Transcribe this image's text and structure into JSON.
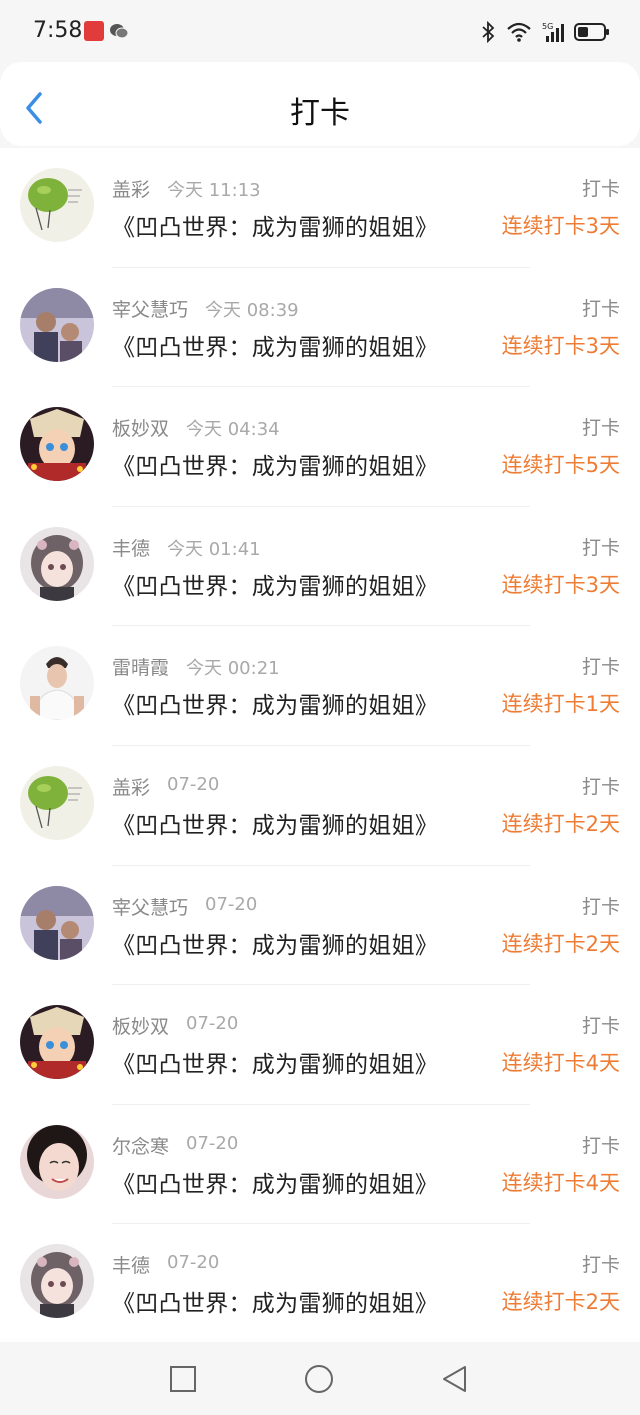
{
  "status_bar": {
    "time": "7:58",
    "network": "5G"
  },
  "header": {
    "title": "打卡"
  },
  "colors": {
    "accent": "#ef7c34",
    "back_arrow": "#3a8ee6"
  },
  "items": [
    {
      "name": "盖彩",
      "time": "今天 11:13",
      "book": "《凹凸世界：成为雷狮的姐姐》",
      "kind": "打卡",
      "streak": "连续打卡3天",
      "avatar": "lime-photo"
    },
    {
      "name": "宰父慧巧",
      "time": "今天 08:39",
      "book": "《凹凸世界：成为雷狮的姐姐》",
      "kind": "打卡",
      "streak": "连续打卡3天",
      "avatar": "group-photo"
    },
    {
      "name": "板妙双",
      "time": "今天 04:34",
      "book": "《凹凸世界：成为雷狮的姐姐》",
      "kind": "打卡",
      "streak": "连续打卡5天",
      "avatar": "anime-red"
    },
    {
      "name": "丰德",
      "time": "今天 01:41",
      "book": "《凹凸世界：成为雷狮的姐姐》",
      "kind": "打卡",
      "streak": "连续打卡3天",
      "avatar": "anime-girl"
    },
    {
      "name": "雷晴霞",
      "time": "今天 00:21",
      "book": "《凹凸世界：成为雷狮的姐姐》",
      "kind": "打卡",
      "streak": "连续打卡1天",
      "avatar": "man-photo"
    },
    {
      "name": "盖彩",
      "time": "07-20",
      "book": "《凹凸世界：成为雷狮的姐姐》",
      "kind": "打卡",
      "streak": "连续打卡2天",
      "avatar": "lime-photo"
    },
    {
      "name": "宰父慧巧",
      "time": "07-20",
      "book": "《凹凸世界：成为雷狮的姐姐》",
      "kind": "打卡",
      "streak": "连续打卡2天",
      "avatar": "group-photo"
    },
    {
      "name": "板妙双",
      "time": "07-20",
      "book": "《凹凸世界：成为雷狮的姐姐》",
      "kind": "打卡",
      "streak": "连续打卡4天",
      "avatar": "anime-red"
    },
    {
      "name": "尔念寒",
      "time": "07-20",
      "book": "《凹凸世界：成为雷狮的姐姐》",
      "kind": "打卡",
      "streak": "连续打卡4天",
      "avatar": "girl-photo"
    },
    {
      "name": "丰德",
      "time": "07-20",
      "book": "《凹凸世界：成为雷狮的姐姐》",
      "kind": "打卡",
      "streak": "连续打卡2天",
      "avatar": "anime-girl"
    }
  ]
}
